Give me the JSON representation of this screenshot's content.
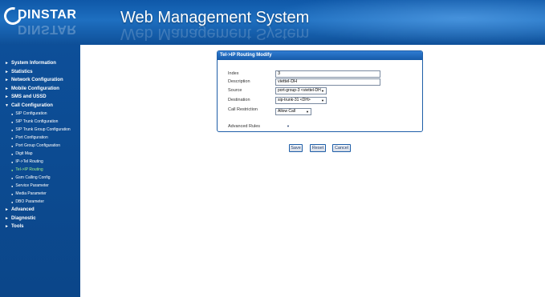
{
  "header": {
    "logo_text": "DINSTAR",
    "title": "Web Management System"
  },
  "sidebar": {
    "items": [
      {
        "label": "System Information"
      },
      {
        "label": "Statistics"
      },
      {
        "label": "Network Configuration"
      },
      {
        "label": "Mobile Configuration"
      },
      {
        "label": "SMS and USSD"
      },
      {
        "label": "Call Configuration"
      }
    ],
    "call_sub_items": [
      {
        "label": "SIP Configuration"
      },
      {
        "label": "SIP Trunk Configuration"
      },
      {
        "label": "SIP Trunk Group Configuration"
      },
      {
        "label": "Port Configuration"
      },
      {
        "label": "Port Group Configuration"
      },
      {
        "label": "Digit Map"
      },
      {
        "label": "IP->Tel Routing"
      },
      {
        "label": "Tel->IP Routing"
      },
      {
        "label": "Gsm Calling Config"
      },
      {
        "label": "Service Parameter"
      },
      {
        "label": "Media Parameter"
      },
      {
        "label": "DBO Parameter"
      }
    ],
    "bottom_items": [
      {
        "label": "Advanced"
      },
      {
        "label": "Diagnostic"
      },
      {
        "label": "Tools"
      }
    ],
    "active_color": "#9ef08a"
  },
  "panel": {
    "title": "Tel->IP Routing Modify",
    "index_label": "Index",
    "index_value": "3",
    "description_label": "Description",
    "description_value": "viettel-DH",
    "source_label": "Source",
    "source_value": "port-group-3 <viettel-DH",
    "destination_label": "Destination",
    "destination_value": "sip-trunk-31 <DH>",
    "call_restriction_label": "Call Restriction",
    "call_restriction_value": "Allow Call",
    "advanced_rules_label": "Advanced Rules"
  },
  "buttons": {
    "save": "Save",
    "reset": "Reset",
    "cancel": "Cancel"
  },
  "colors": {
    "header_blue": "#1e6fc0",
    "sidebar_blue": "#0d4f99",
    "panel_border": "#1e5ea8"
  }
}
